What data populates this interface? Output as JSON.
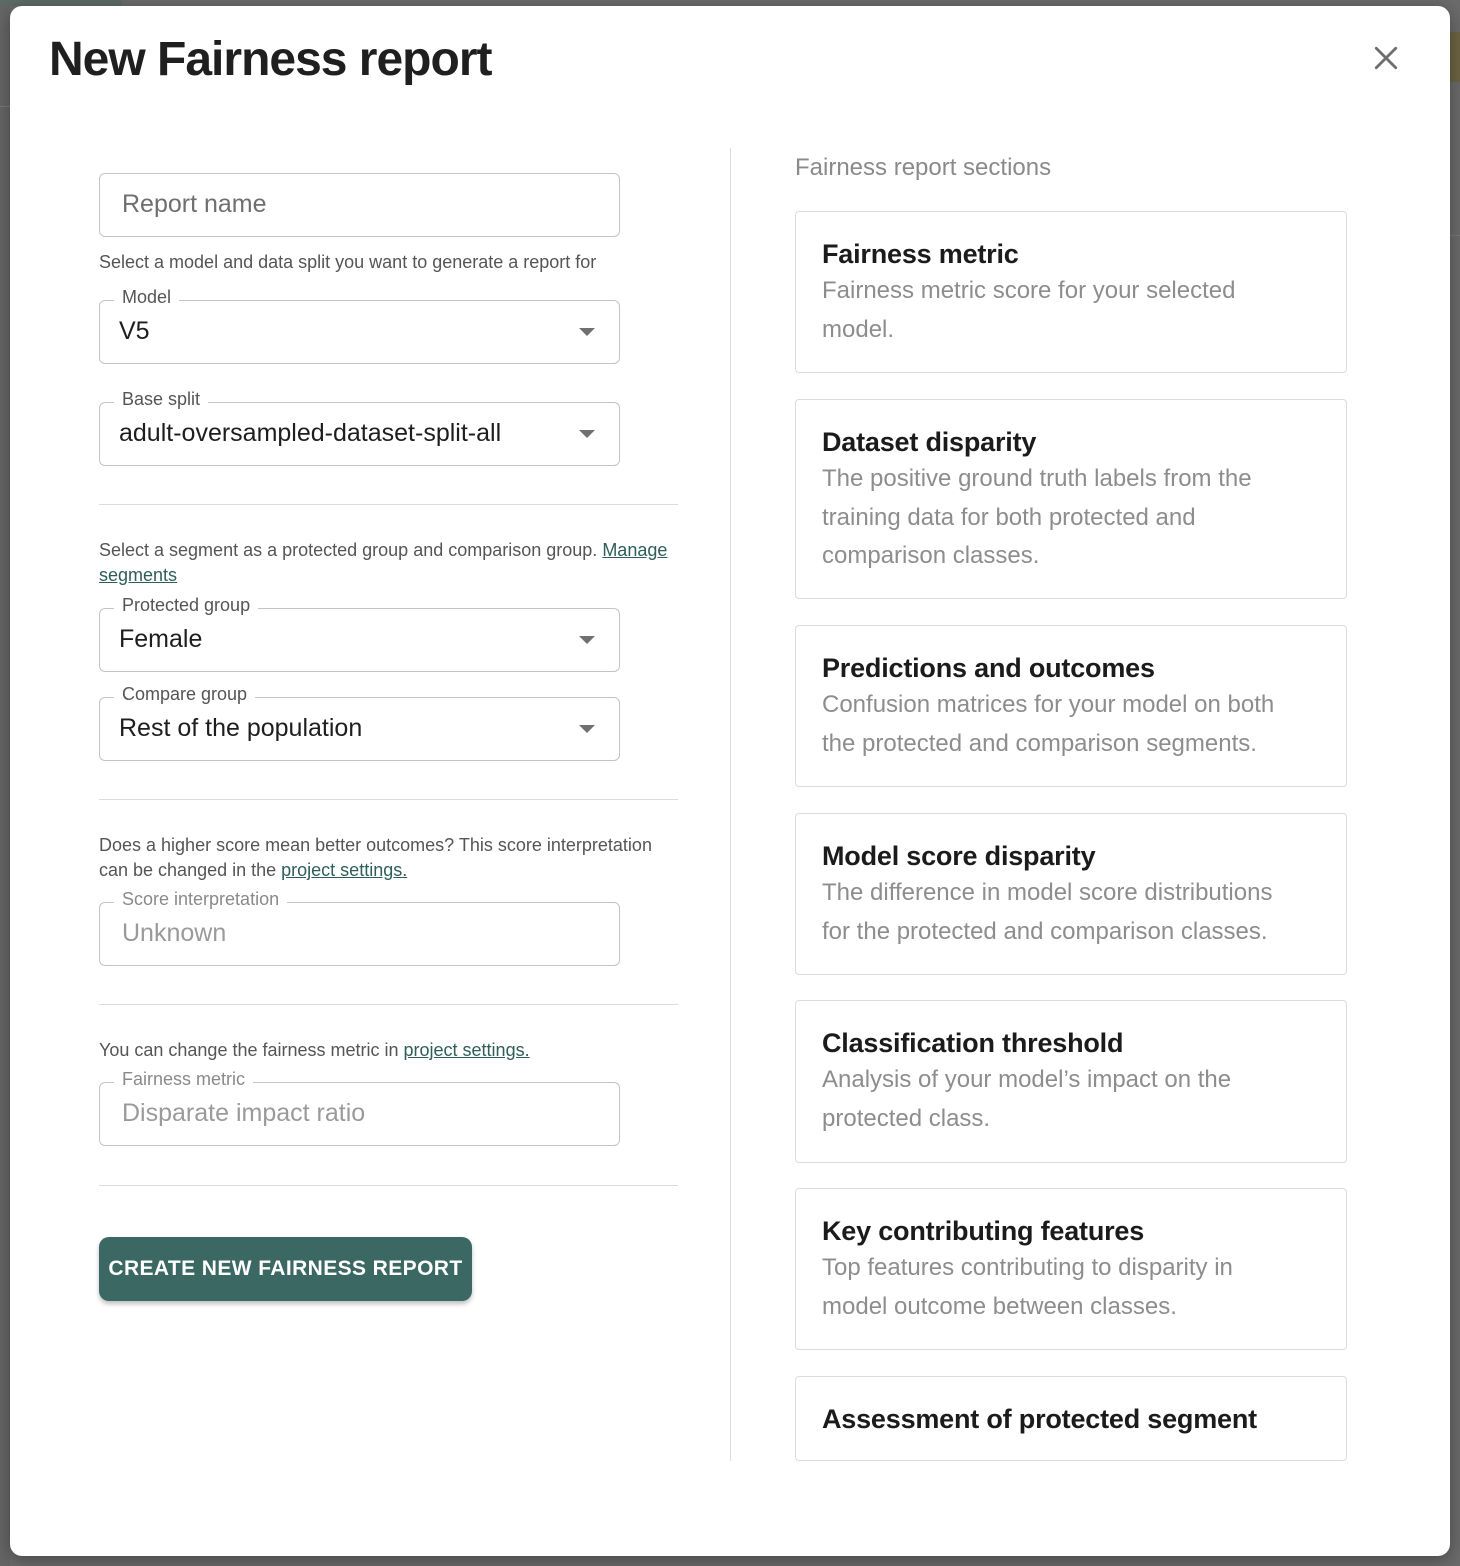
{
  "modal": {
    "title": "New Fairness report",
    "close_icon": "close-icon"
  },
  "form": {
    "report_name": {
      "placeholder": "Report name",
      "value": ""
    },
    "model_helper": "Select a model and data split you want to generate a report for",
    "model": {
      "label": "Model",
      "value": "V5"
    },
    "base_split": {
      "label": "Base split",
      "value": "adult-oversampled-dataset-split-all"
    },
    "segment_helper": "Select a segment as a protected group and comparison group. ",
    "segment_link": "Manage segments",
    "protected_group": {
      "label": "Protected group",
      "value": "Female"
    },
    "compare_group": {
      "label": "Compare group",
      "value": "Rest of the population"
    },
    "score_helper": "Does a higher score mean better outcomes? This score interpretation can be changed in the ",
    "score_link": "project settings.",
    "score_interpretation": {
      "label": "Score interpretation",
      "value": "Unknown"
    },
    "metric_helper": "You can change the fairness metric in ",
    "metric_link": "project settings.",
    "fairness_metric": {
      "label": "Fairness metric",
      "value": "Disparate impact ratio"
    },
    "submit_label": "CREATE NEW FAIRNESS REPORT"
  },
  "sections": {
    "title": "Fairness report sections",
    "cards": [
      {
        "title": "Fairness metric",
        "description": "Fairness metric score for your selected model."
      },
      {
        "title": "Dataset disparity",
        "description": "The positive ground truth labels from the training data for both protected and comparison classes."
      },
      {
        "title": "Predictions and outcomes",
        "description": "Confusion matrices for your model on both the protected and comparison segments."
      },
      {
        "title": "Model score disparity",
        "description": "The difference in model score distributions for the protected and comparison classes."
      },
      {
        "title": "Classification threshold",
        "description": "Analysis of your model’s impact on the protected class."
      },
      {
        "title": "Key contributing features",
        "description": "Top features contributing to disparity in model outcome between classes."
      },
      {
        "title": "Assessment of protected segment",
        "description": ""
      }
    ]
  },
  "colors": {
    "primary": "#3b6863",
    "link": "#2e5e58",
    "overlay": "#6b6b6b"
  }
}
